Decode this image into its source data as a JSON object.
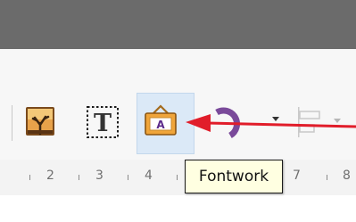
{
  "toolbar": {
    "buttons": [
      {
        "name": "insert-image",
        "icon": "image-icon"
      },
      {
        "name": "insert-text-box",
        "icon": "text-box-icon",
        "glyph": "T"
      },
      {
        "name": "fontwork",
        "icon": "fontwork-icon",
        "glyph": "A",
        "active": true
      },
      {
        "name": "shapes",
        "icon": "shape-icon"
      },
      {
        "name": "align",
        "icon": "align-icon"
      }
    ]
  },
  "tooltip": {
    "text": "Fontwork"
  },
  "ruler": {
    "labels": [
      "2",
      "3",
      "4",
      "7",
      "8"
    ]
  },
  "colors": {
    "titlebar": "#6b6b6b",
    "toolbar": "#f7f7f7",
    "highlight": "#dbe9f7",
    "tooltip_bg": "#ffffe1",
    "annotation": "#e11d2a"
  }
}
